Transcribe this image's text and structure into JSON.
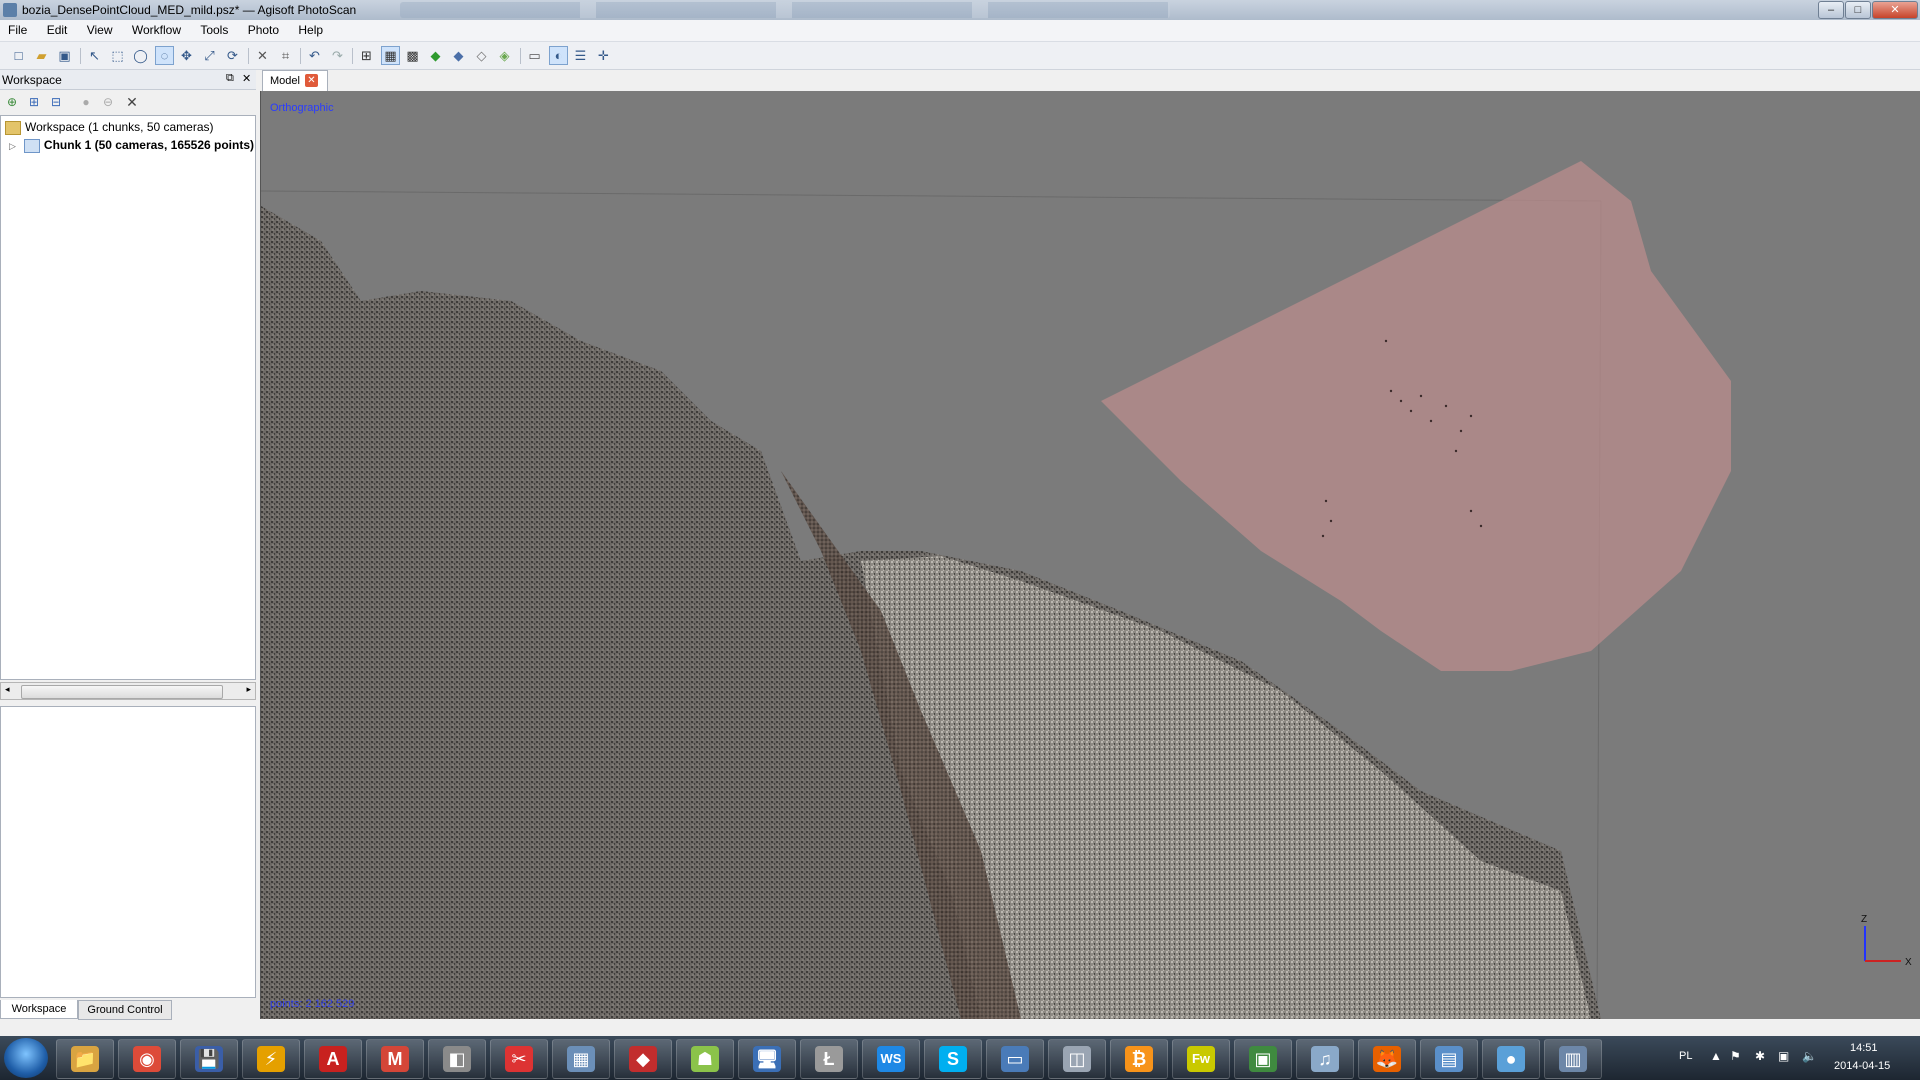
{
  "window": {
    "title": "bozia_DensePointCloud_MED_mild.psz* — Agisoft PhotoScan",
    "controls": {
      "minimize": "–",
      "maximize": "□",
      "close": "✕"
    }
  },
  "menu": [
    "File",
    "Edit",
    "View",
    "Workflow",
    "Tools",
    "Photo",
    "Help"
  ],
  "toolbar": {
    "icons": [
      "new-icon",
      "open-icon",
      "save-icon",
      "select-icon",
      "rectangle-select-icon",
      "circle-select-icon",
      "free-form-select-icon",
      "navigation-icon",
      "resize-region-icon",
      "rotate-region-icon",
      "delete-icon",
      "crop-icon",
      "undo-icon",
      "redo-icon",
      "show-cameras-icon",
      "show-points-icon",
      "show-dense-cloud-icon",
      "shaded-model-icon",
      "solid-model-icon",
      "wireframe-model-icon",
      "textured-model-icon",
      "show-region-icon",
      "show-trackball-icon",
      "show-info-icon",
      "reset-view-icon"
    ]
  },
  "workspace": {
    "title": "Workspace",
    "tree": {
      "root": "Workspace (1 chunks, 50 cameras)",
      "chunk": "Chunk 1 (50 cameras, 165526 points)"
    },
    "bottom_tabs": [
      "Workspace",
      "Ground Control"
    ]
  },
  "model": {
    "tab_label": "Model",
    "view_mode": "Orthographic",
    "status": "points: 2 162 529",
    "axis": {
      "z": "Z",
      "x": "X"
    }
  },
  "taskbar": {
    "apps": [
      {
        "name": "explorer-icon",
        "glyph": "📁",
        "color": "#d9a441"
      },
      {
        "name": "chrome-icon",
        "glyph": "◉",
        "color": "#dd4b39"
      },
      {
        "name": "floppy-save-icon",
        "glyph": "💾",
        "color": "#3a5ea8"
      },
      {
        "name": "lightning-app-icon",
        "glyph": "⚡",
        "color": "#e5a000"
      },
      {
        "name": "acrobat-icon",
        "glyph": "A",
        "color": "#c8211f"
      },
      {
        "name": "gmail-icon",
        "glyph": "M",
        "color": "#d44638"
      },
      {
        "name": "virtual-cube-icon",
        "glyph": "◧",
        "color": "#8a8a8a"
      },
      {
        "name": "scissors-icon",
        "glyph": "✂",
        "color": "#d33"
      },
      {
        "name": "calculator-icon",
        "glyph": "▦",
        "color": "#6b8fb8"
      },
      {
        "name": "sketchup-icon",
        "glyph": "◆",
        "color": "#c22d2d"
      },
      {
        "name": "android-icon",
        "glyph": "☗",
        "color": "#8bc34a"
      },
      {
        "name": "computer-icon",
        "glyph": "🖥",
        "color": "#3b6fb6"
      },
      {
        "name": "litecoin-icon",
        "glyph": "Ł",
        "color": "#9a9a9a"
      },
      {
        "name": "webstorm-icon",
        "glyph": "WS",
        "color": "#1e88e5"
      },
      {
        "name": "skype-icon",
        "glyph": "S",
        "color": "#00aff0"
      },
      {
        "name": "window-manager-icon",
        "glyph": "▭",
        "color": "#4a7bb8"
      },
      {
        "name": "photoscan-icon",
        "glyph": "◫",
        "color": "#9aa5b3"
      },
      {
        "name": "bitcoin-icon",
        "glyph": "₿",
        "color": "#f7931a"
      },
      {
        "name": "fireworks-icon",
        "glyph": "Fw",
        "color": "#c9c900"
      },
      {
        "name": "terminal-icon",
        "glyph": "▣",
        "color": "#3f8a3f"
      },
      {
        "name": "itunes-icon",
        "glyph": "♫",
        "color": "#8aa9c9"
      },
      {
        "name": "firefox-icon",
        "glyph": "🦊",
        "color": "#e66000"
      },
      {
        "name": "remote-desktop-icon",
        "glyph": "▤",
        "color": "#5a8fc9"
      },
      {
        "name": "water-drop-icon",
        "glyph": "●",
        "color": "#5aa0d8"
      },
      {
        "name": "film-icon",
        "glyph": "▥",
        "color": "#6d87a8"
      }
    ],
    "tray": {
      "lang": "PL",
      "time": "14:51",
      "date": "2014-04-15"
    }
  }
}
